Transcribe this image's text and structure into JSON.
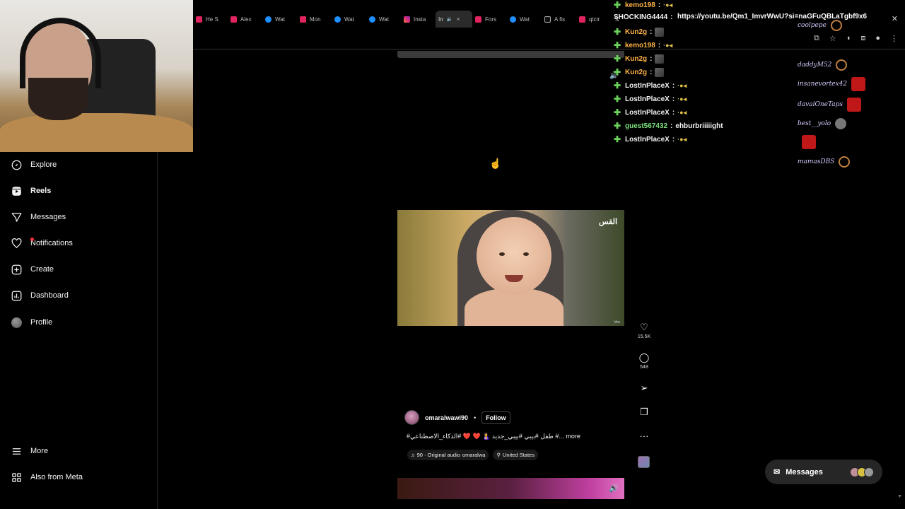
{
  "browser": {
    "tabs": [
      {
        "label": "He S",
        "favicon": "yt"
      },
      {
        "label": "Alex",
        "favicon": "yt"
      },
      {
        "label": "Wat",
        "favicon": "ms"
      },
      {
        "label": "Mon",
        "favicon": "yt"
      },
      {
        "label": "Wat",
        "favicon": "ms"
      },
      {
        "label": "Wat",
        "favicon": "ms"
      },
      {
        "label": "Insta",
        "favicon": "ig"
      },
      {
        "label": "In",
        "favicon": "none",
        "active": true
      },
      {
        "label": "Fors",
        "favicon": "yt"
      },
      {
        "label": "Wat",
        "favicon": "ms"
      },
      {
        "label": "A fis",
        "favicon": "tt"
      },
      {
        "label": "qtcir",
        "favicon": "yt"
      },
      {
        "label": "",
        "favicon": "x"
      }
    ],
    "url_overlay": "https://youtu.be/Qm1_ImvrWwU?si=naGFuQBLaTgbf9x6",
    "close_glyph": "✕"
  },
  "sidebar": {
    "items": [
      {
        "label": "Explore",
        "icon": "compass-icon"
      },
      {
        "label": "Reels",
        "icon": "reels-icon",
        "active": true
      },
      {
        "label": "Messages",
        "icon": "send-icon"
      },
      {
        "label": "Notifications",
        "icon": "heart-icon"
      },
      {
        "label": "Create",
        "icon": "plus-square-icon"
      },
      {
        "label": "Dashboard",
        "icon": "bar-chart-icon"
      },
      {
        "label": "Profile",
        "icon": "avatar"
      }
    ],
    "more_label": "More",
    "meta_label": "Also from Meta"
  },
  "reel": {
    "watermark": "القس",
    "video_tag": "Veo",
    "author": "omaralwawi90",
    "separator": "•",
    "follow_label": "Follow",
    "caption": "#طفل #بيبي #بيبي_جديد 🤱 ❤️ ❤️ #الذكاء_الاصطناعي #... more",
    "audio_label": "90 · Original audio",
    "audio_author": "omaralwa",
    "location": "United States",
    "likes": "15.5K",
    "comments": "548"
  },
  "chat": {
    "lines": [
      {
        "user": "kemo198",
        "msg": "",
        "emote": "dots",
        "color": "orange"
      },
      {
        "user": "SHOCKING4444",
        "msg": "",
        "emote": "",
        "color": "white"
      },
      {
        "user": "Kun2g",
        "msg": "",
        "emote": "box",
        "color": "orange"
      },
      {
        "user": "kemo198",
        "msg": "",
        "emote": "dots",
        "color": "orange"
      },
      {
        "user": "Kun2g",
        "msg": "",
        "emote": "box",
        "color": "orange"
      },
      {
        "user": "Kun2g",
        "msg": "",
        "emote": "box",
        "color": "orange"
      },
      {
        "user": "LostInPlaceX",
        "msg": "",
        "emote": "dots",
        "color": "white"
      },
      {
        "user": "LostInPlaceX",
        "msg": "",
        "emote": "dots",
        "color": "white"
      },
      {
        "user": "LostInPlaceX",
        "msg": "",
        "emote": "dots",
        "color": "white"
      },
      {
        "user": "guest567432",
        "msg": "ehburbriiiiight",
        "emote": "",
        "color": "green"
      },
      {
        "user": "LostInPlaceX",
        "msg": "",
        "emote": "dots",
        "color": "white"
      }
    ],
    "separator": ":"
  },
  "floating_users": [
    {
      "name": "coolpepe",
      "icon": "ring"
    },
    {
      "name": "daddyM52",
      "icon": "ring"
    },
    {
      "name": "insanevortex42",
      "icon": "red"
    },
    {
      "name": "davaiOneTaps",
      "icon": "red"
    },
    {
      "name": "best__yolo",
      "icon": "gray"
    },
    {
      "name": "",
      "icon": "red"
    },
    {
      "name": "mamasDBS",
      "icon": "ring"
    }
  ],
  "messages_pill": {
    "label": "Messages"
  },
  "colors": {
    "accent_green": "#6bd25b",
    "notif_red": "#ff3040",
    "bg": "#000000"
  }
}
